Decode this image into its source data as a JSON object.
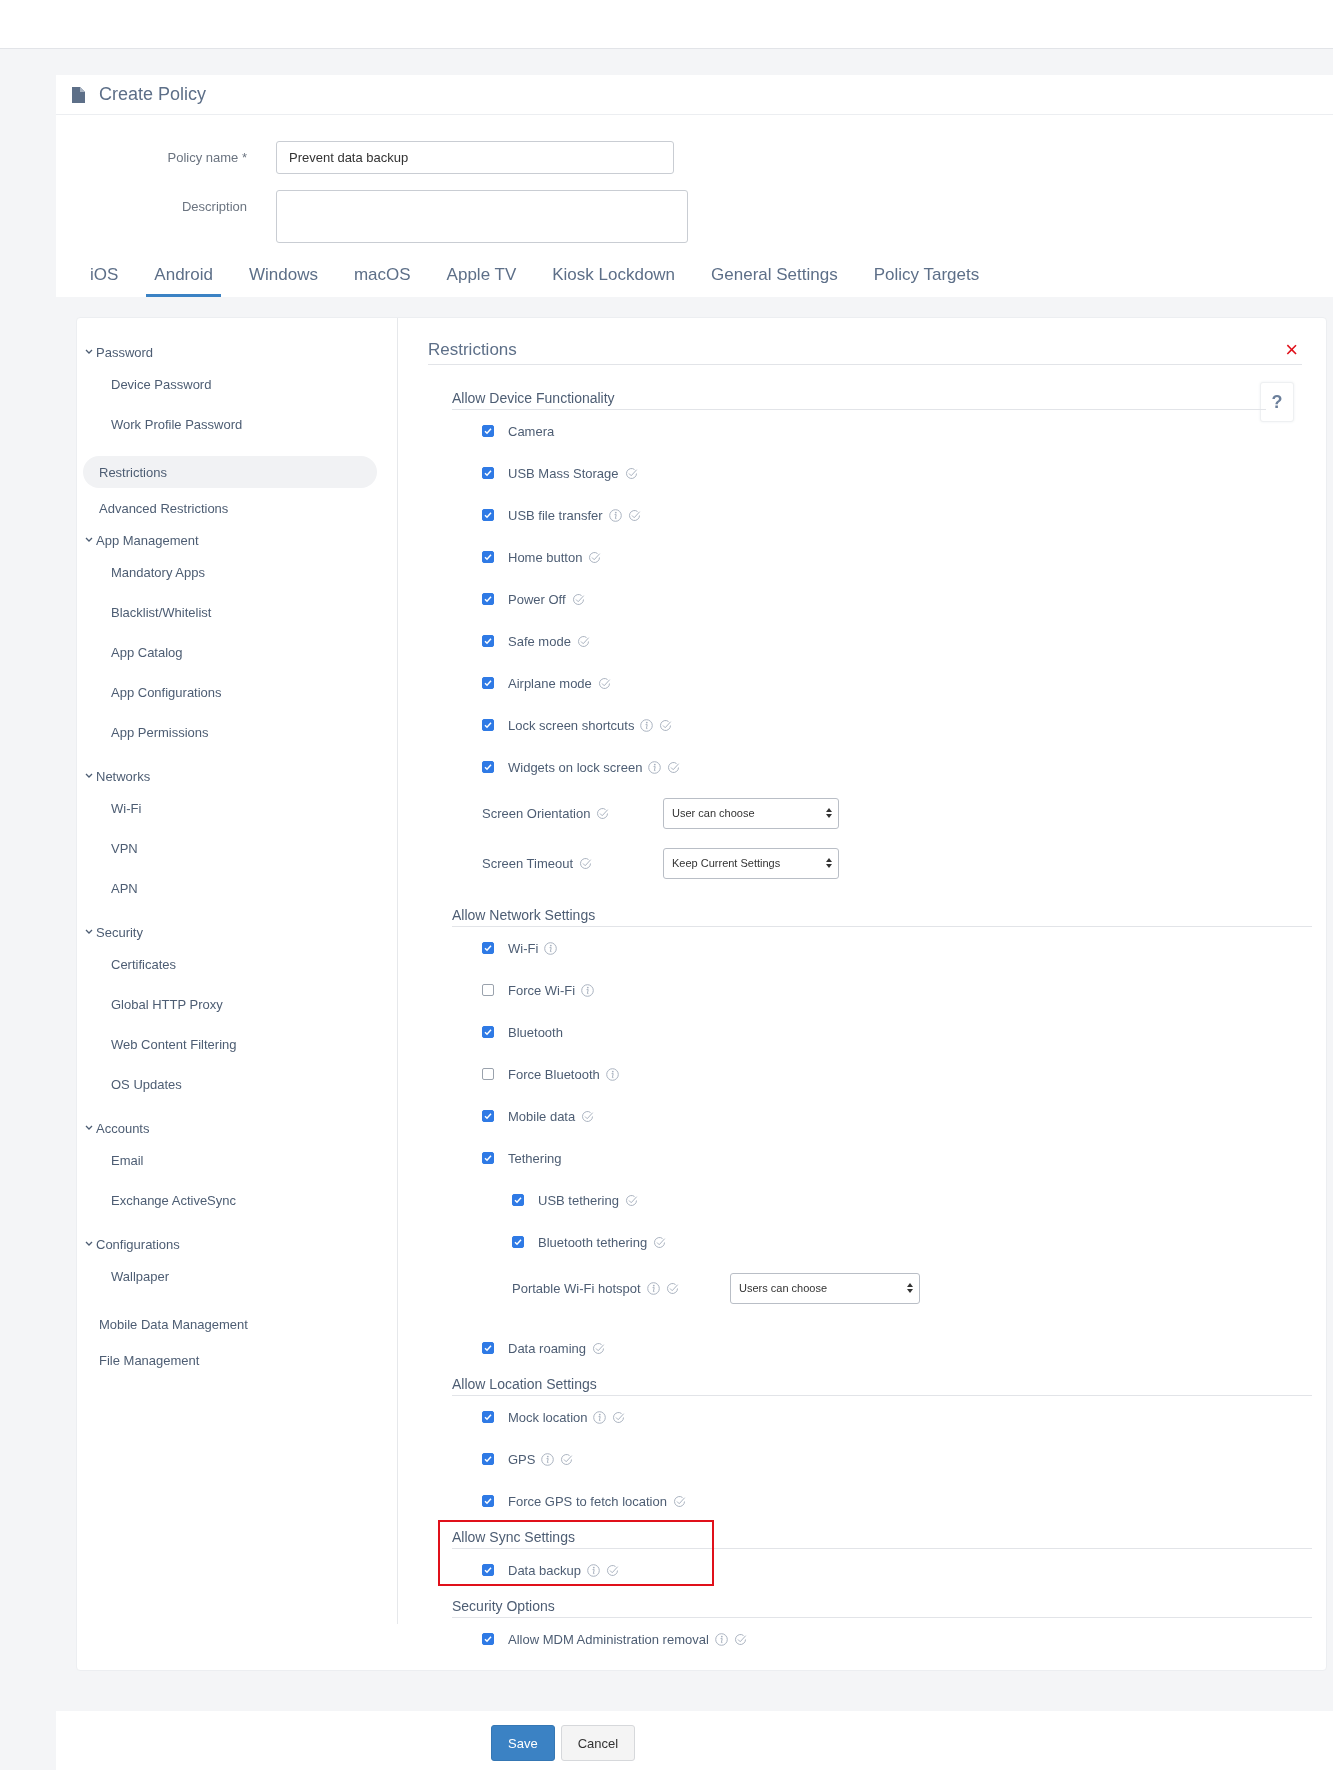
{
  "page": {
    "title": "Create Policy"
  },
  "form": {
    "fields": [
      {
        "kind": "input",
        "label": "Policy name *",
        "value": "Prevent data backup"
      },
      {
        "kind": "textarea",
        "label": "Description"
      }
    ]
  },
  "tabs": [
    {
      "label": "iOS",
      "selected": false
    },
    {
      "label": "Android",
      "selected": true
    },
    {
      "label": "Windows",
      "selected": false
    },
    {
      "label": "macOS",
      "selected": false
    },
    {
      "label": "Apple TV",
      "selected": false
    },
    {
      "label": "Kiosk Lockdown",
      "selected": false
    },
    {
      "label": "General Settings",
      "selected": false
    },
    {
      "label": "Policy Targets",
      "selected": false
    }
  ],
  "sidebar": {
    "items": [
      {
        "label": "Password",
        "expanded": true,
        "children": [
          {
            "label": "Device Password",
            "selected": false
          },
          {
            "label": "Work Profile Password",
            "selected": false
          }
        ]
      },
      {
        "label": "Restrictions",
        "selected": true
      },
      {
        "label": "Advanced Restrictions",
        "selected": false
      },
      {
        "label": "App Management",
        "expanded": true,
        "children": [
          {
            "label": "Mandatory Apps",
            "selected": false
          },
          {
            "label": "Blacklist/Whitelist",
            "selected": false
          },
          {
            "label": "App Catalog",
            "selected": false
          },
          {
            "label": "App Configurations",
            "selected": false
          },
          {
            "label": "App Permissions",
            "selected": false
          }
        ]
      },
      {
        "label": "Networks",
        "expanded": true,
        "children": [
          {
            "label": "Wi-Fi",
            "selected": false
          },
          {
            "label": "VPN",
            "selected": false
          },
          {
            "label": "APN",
            "selected": false
          }
        ]
      },
      {
        "label": "Security",
        "expanded": true,
        "children": [
          {
            "label": "Certificates",
            "selected": false
          },
          {
            "label": "Global HTTP Proxy",
            "selected": false
          },
          {
            "label": "Web Content Filtering",
            "selected": false
          },
          {
            "label": "OS Updates",
            "selected": false
          }
        ]
      },
      {
        "label": "Accounts",
        "expanded": true,
        "children": [
          {
            "label": "Email",
            "selected": false
          },
          {
            "label": "Exchange ActiveSync",
            "selected": false
          }
        ]
      },
      {
        "label": "Configurations",
        "expanded": true,
        "children": [
          {
            "label": "Wallpaper",
            "selected": false
          }
        ]
      },
      {
        "label": "Mobile Data Management",
        "selected": false
      },
      {
        "label": "File Management",
        "selected": false
      }
    ]
  },
  "panel": {
    "title": "Restrictions",
    "close": "×",
    "help": "?",
    "sections": [
      {
        "title": "Allow Device Functionality",
        "highlighted": false,
        "items": [
          {
            "kind": "checkbox",
            "label": "Camera",
            "checked": true,
            "info": false,
            "verified": false
          },
          {
            "kind": "checkbox",
            "label": "USB Mass Storage",
            "checked": true,
            "info": false,
            "verified": true
          },
          {
            "kind": "checkbox",
            "label": "USB file transfer",
            "checked": true,
            "info": true,
            "verified": true
          },
          {
            "kind": "checkbox",
            "label": "Home button",
            "checked": true,
            "info": false,
            "verified": true
          },
          {
            "kind": "checkbox",
            "label": "Power Off",
            "checked": true,
            "info": false,
            "verified": true
          },
          {
            "kind": "checkbox",
            "label": "Safe mode",
            "checked": true,
            "info": false,
            "verified": true
          },
          {
            "kind": "checkbox",
            "label": "Airplane mode",
            "checked": true,
            "info": false,
            "verified": true
          },
          {
            "kind": "checkbox",
            "label": "Lock screen shortcuts",
            "checked": true,
            "info": true,
            "verified": true
          },
          {
            "kind": "checkbox",
            "label": "Widgets on lock screen",
            "checked": true,
            "info": true,
            "verified": true
          },
          {
            "kind": "select",
            "label": "Screen Orientation",
            "value": "User can choose",
            "info": false,
            "verified": true
          },
          {
            "kind": "select",
            "label": "Screen Timeout",
            "value": "Keep Current Settings",
            "info": false,
            "verified": true
          }
        ]
      },
      {
        "title": "Allow Network Settings",
        "highlighted": false,
        "items": [
          {
            "kind": "checkbox",
            "label": "Wi-Fi",
            "checked": true,
            "info": true,
            "verified": false
          },
          {
            "kind": "checkbox",
            "label": "Force Wi-Fi",
            "checked": false,
            "info": true,
            "verified": false
          },
          {
            "kind": "checkbox",
            "label": "Bluetooth",
            "checked": true,
            "info": false,
            "verified": false
          },
          {
            "kind": "checkbox",
            "label": "Force Bluetooth",
            "checked": false,
            "info": true,
            "verified": false
          },
          {
            "kind": "checkbox",
            "label": "Mobile data",
            "checked": true,
            "info": false,
            "verified": true
          },
          {
            "kind": "checkbox",
            "label": "Tethering",
            "checked": true,
            "info": false,
            "verified": false,
            "children": [
              {
                "kind": "checkbox",
                "label": "USB tethering",
                "checked": true,
                "info": false,
                "verified": true
              },
              {
                "kind": "checkbox",
                "label": "Bluetooth tethering",
                "checked": true,
                "info": false,
                "verified": true
              },
              {
                "kind": "select",
                "label": "Portable Wi-Fi hotspot",
                "value": "Users can choose",
                "info": true,
                "verified": true
              }
            ]
          },
          {
            "kind": "checkbox",
            "label": "Data roaming",
            "checked": true,
            "info": false,
            "verified": true
          }
        ]
      },
      {
        "title": "Allow Location Settings",
        "highlighted": false,
        "items": [
          {
            "kind": "checkbox",
            "label": "Mock location",
            "checked": true,
            "info": true,
            "verified": true
          },
          {
            "kind": "checkbox",
            "label": "GPS",
            "checked": true,
            "info": true,
            "verified": true
          },
          {
            "kind": "checkbox",
            "label": "Force GPS to fetch location",
            "checked": true,
            "info": false,
            "verified": true
          }
        ]
      },
      {
        "title": "Allow Sync Settings",
        "highlighted": true,
        "items": [
          {
            "kind": "checkbox",
            "label": "Data backup",
            "checked": true,
            "info": true,
            "verified": true
          }
        ]
      },
      {
        "title": "Security Options",
        "highlighted": false,
        "items": [
          {
            "kind": "checkbox",
            "label": "Allow MDM Administration removal",
            "checked": true,
            "info": true,
            "verified": true
          }
        ]
      }
    ]
  },
  "buttons": [
    {
      "kind": "primary",
      "label": "Save"
    },
    {
      "kind": "secondary",
      "label": "Cancel"
    }
  ]
}
